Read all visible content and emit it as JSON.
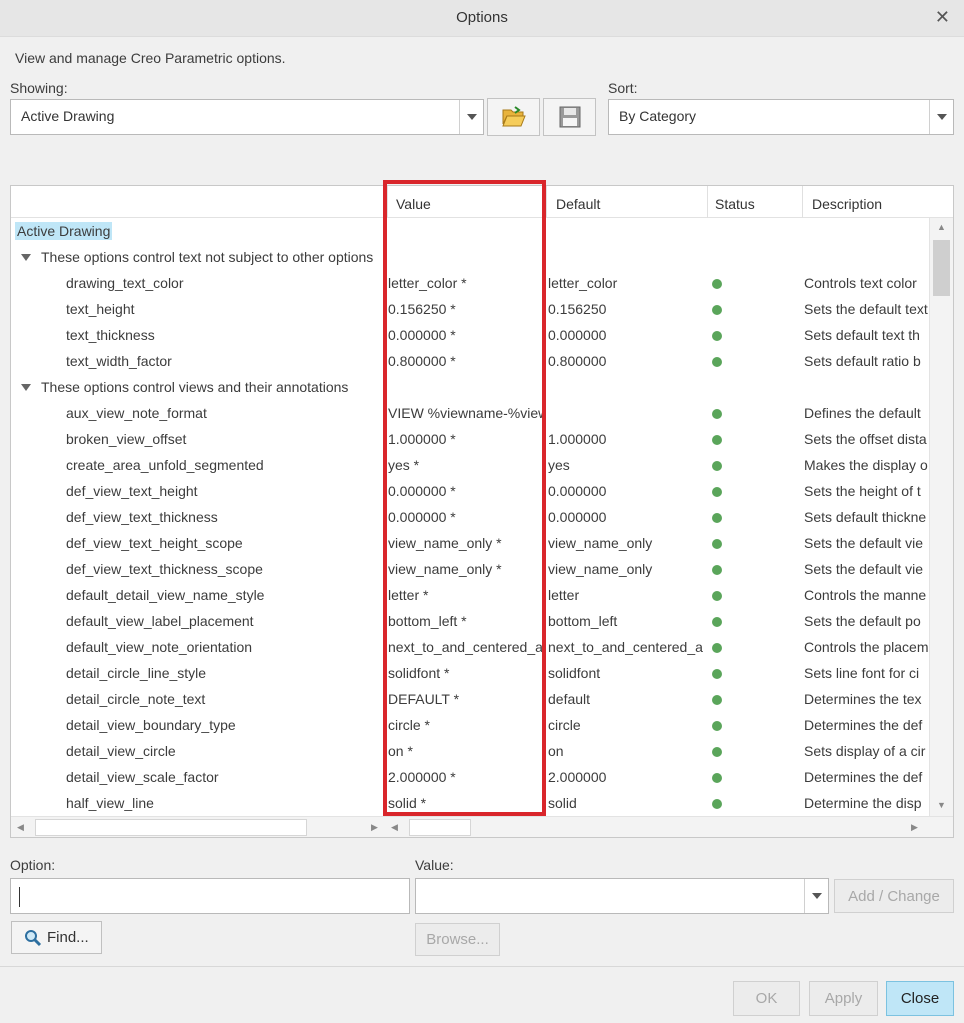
{
  "window": {
    "title": "Options"
  },
  "subtitle": "View and manage Creo Parametric options.",
  "showing": {
    "label": "Showing:",
    "value": "Active Drawing"
  },
  "sort": {
    "label": "Sort:",
    "value": "By Category"
  },
  "table": {
    "columns": [
      "Value",
      "Default",
      "Status",
      "Description"
    ],
    "root": "Active Drawing",
    "rows": [
      {
        "type": "group",
        "label": "These options control text not subject to other options"
      },
      {
        "type": "item",
        "name": "drawing_text_color",
        "value": "letter_color *",
        "default": "letter_color",
        "desc": "Controls text color"
      },
      {
        "type": "item",
        "name": "text_height",
        "value": "0.156250 *",
        "default": "0.156250",
        "desc": "Sets the default text"
      },
      {
        "type": "item",
        "name": "text_thickness",
        "value": "0.000000 *",
        "default": "0.000000",
        "desc": "Sets default text th"
      },
      {
        "type": "item",
        "name": "text_width_factor",
        "value": "0.800000 *",
        "default": "0.800000",
        "desc": "Sets default ratio b"
      },
      {
        "type": "group",
        "label": "These options control views and their annotations"
      },
      {
        "type": "item",
        "name": "aux_view_note_format",
        "value": "VIEW %viewname-%view",
        "default": "",
        "desc": "Defines the default"
      },
      {
        "type": "item",
        "name": "broken_view_offset",
        "value": "1.000000 *",
        "default": "1.000000",
        "desc": "Sets the offset dista"
      },
      {
        "type": "item",
        "name": "create_area_unfold_segmented",
        "value": "yes *",
        "default": "yes",
        "desc": "Makes the display o"
      },
      {
        "type": "item",
        "name": "def_view_text_height",
        "value": "0.000000 *",
        "default": "0.000000",
        "desc": "Sets the height of t"
      },
      {
        "type": "item",
        "name": "def_view_text_thickness",
        "value": "0.000000 *",
        "default": "0.000000",
        "desc": "Sets default thickne"
      },
      {
        "type": "item",
        "name": "def_view_text_height_scope",
        "value": "view_name_only *",
        "default": "view_name_only",
        "desc": "Sets the default vie"
      },
      {
        "type": "item",
        "name": "def_view_text_thickness_scope",
        "value": "view_name_only *",
        "default": "view_name_only",
        "desc": "Sets the default vie"
      },
      {
        "type": "item",
        "name": "default_detail_view_name_style",
        "value": "letter *",
        "default": "letter",
        "desc": "Controls the manne"
      },
      {
        "type": "item",
        "name": "default_view_label_placement",
        "value": "bottom_left *",
        "default": "bottom_left",
        "desc": "Sets the default po"
      },
      {
        "type": "item",
        "name": "default_view_note_orientation",
        "value": "next_to_and_centered_a",
        "default": "next_to_and_centered_a",
        "desc": "Controls the placem"
      },
      {
        "type": "item",
        "name": "detail_circle_line_style",
        "value": "solidfont *",
        "default": "solidfont",
        "desc": "Sets line font for ci"
      },
      {
        "type": "item",
        "name": "detail_circle_note_text",
        "value": "DEFAULT *",
        "default": "default",
        "desc": "Determines the tex"
      },
      {
        "type": "item",
        "name": "detail_view_boundary_type",
        "value": "circle *",
        "default": "circle",
        "desc": "Determines the def"
      },
      {
        "type": "item",
        "name": "detail_view_circle",
        "value": "on *",
        "default": "on",
        "desc": "Sets display of a cir"
      },
      {
        "type": "item",
        "name": "detail_view_scale_factor",
        "value": "2.000000 *",
        "default": "2.000000",
        "desc": "Determines the def"
      },
      {
        "type": "item",
        "name": "half_view_line",
        "value": "solid *",
        "default": "solid",
        "desc": "Determine the disp"
      }
    ]
  },
  "option_field": {
    "label": "Option:",
    "value": ""
  },
  "value_field": {
    "label": "Value:",
    "value": ""
  },
  "buttons": {
    "add_change": "Add / Change",
    "find": "Find...",
    "browse": "Browse...",
    "ok": "OK",
    "apply": "Apply",
    "close": "Close"
  },
  "colors": {
    "status_ok": "#5aa55a",
    "highlight": "#d9262b",
    "selection": "#bfe6f7"
  }
}
